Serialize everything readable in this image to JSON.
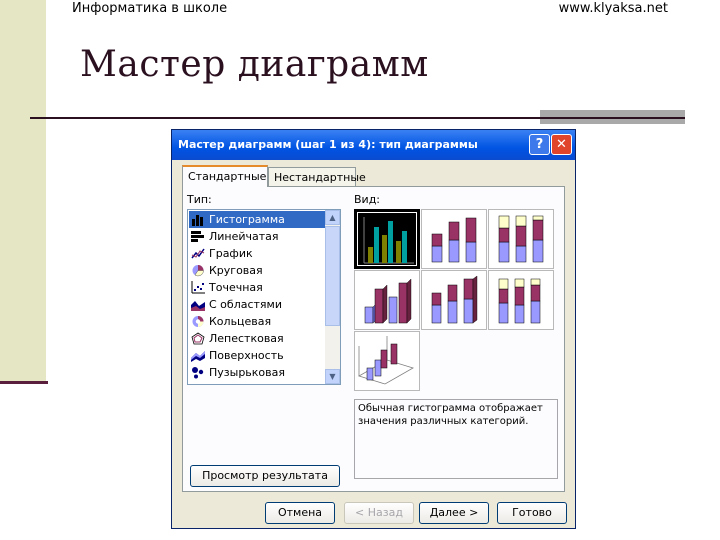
{
  "slide": {
    "header_left": "Информатика в школе",
    "header_right": "www.klyaksa.net",
    "title": "Мастер диаграмм"
  },
  "dialog": {
    "title": "Мастер диаграмм (шаг 1 из 4): тип диаграммы",
    "help_icon": "?",
    "close_icon": "✕",
    "tabs": [
      {
        "label": "Стандартные",
        "active": true
      },
      {
        "label": "Нестандартные",
        "active": false
      }
    ],
    "type_label": "Тип:",
    "view_label": "Вид:",
    "types": [
      {
        "label": "Гистограмма",
        "icon": "column-chart-icon",
        "selected": true
      },
      {
        "label": "Линейчатая",
        "icon": "bar-chart-icon"
      },
      {
        "label": "График",
        "icon": "line-chart-icon"
      },
      {
        "label": "Круговая",
        "icon": "pie-chart-icon"
      },
      {
        "label": "Точечная",
        "icon": "scatter-chart-icon"
      },
      {
        "label": "С областями",
        "icon": "area-chart-icon"
      },
      {
        "label": "Кольцевая",
        "icon": "doughnut-chart-icon"
      },
      {
        "label": "Лепестковая",
        "icon": "radar-chart-icon"
      },
      {
        "label": "Поверхность",
        "icon": "surface-chart-icon"
      },
      {
        "label": "Пузырьковая",
        "icon": "bubble-chart-icon"
      }
    ],
    "description": "Обычная гистограмма отображает значения различных категорий.",
    "preview_button": "Просмотр результата",
    "buttons": {
      "cancel": "Отмена",
      "back": "< Назад",
      "next": "Далее >",
      "done": "Готово"
    },
    "colors": {
      "series1": "#9999ff",
      "series2": "#993366",
      "series3": "#ffffcc",
      "selection": "#316ac5",
      "titlebar": "#0054e3"
    }
  }
}
